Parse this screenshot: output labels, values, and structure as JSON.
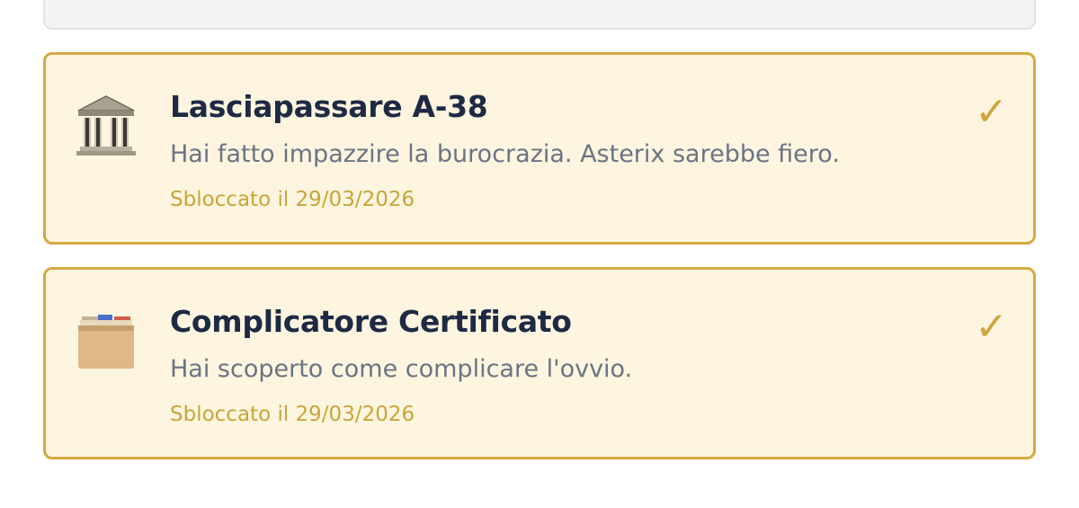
{
  "achievements": [
    {
      "icon": "classical-building-icon",
      "title": "Lasciapassare A-38",
      "description": "Hai fatto impazzire la burocrazia. Asterix sarebbe fiero.",
      "unlocked": "Sbloccato il 29/03/2026",
      "check": "✓"
    },
    {
      "icon": "card-file-box-icon",
      "title": "Complicatore Certificato",
      "description": "Hai scoperto come complicare l'ovvio.",
      "unlocked": "Sbloccato il 29/03/2026",
      "check": "✓"
    }
  ],
  "colors": {
    "card_background": "#fdf5df",
    "card_border": "#d6aa42",
    "title": "#1e2a44",
    "description": "#6b7384",
    "date": "#c9a538",
    "check": "#d0a43e"
  }
}
